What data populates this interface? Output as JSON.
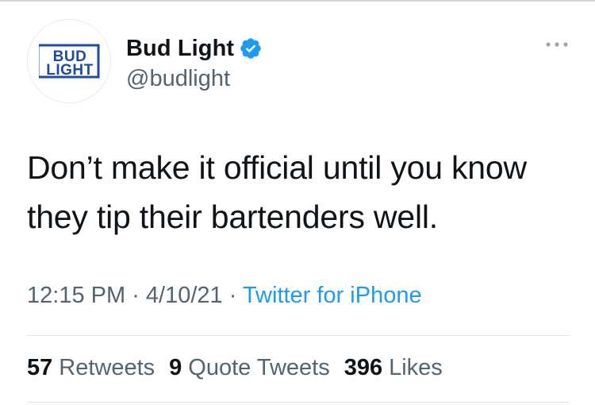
{
  "profile": {
    "display_name": "Bud Light",
    "handle": "@budlight",
    "avatar_logo_lines": [
      "BUD",
      "LIGHT"
    ],
    "verified": true,
    "avatar_icon": "bud-light-logo-icon",
    "verified_icon": "verified-badge-icon"
  },
  "tweet": {
    "text": "Don’t make it official until you know\nthey tip their bartenders well."
  },
  "meta": {
    "time": "12:15 PM",
    "separator1": " · ",
    "date": "4/10/21",
    "separator2": " · ",
    "source": "Twitter for iPhone"
  },
  "stats": {
    "retweets_count": "57",
    "retweets_label": "Retweets",
    "quote_tweets_count": "9",
    "quote_tweets_label": "Quote Tweets",
    "likes_count": "396",
    "likes_label": "Likes"
  },
  "colors": {
    "accent": "#1d9bf0",
    "text_primary": "#0f1419",
    "text_secondary": "#536471",
    "logo_blue": "#1e4ba0"
  }
}
